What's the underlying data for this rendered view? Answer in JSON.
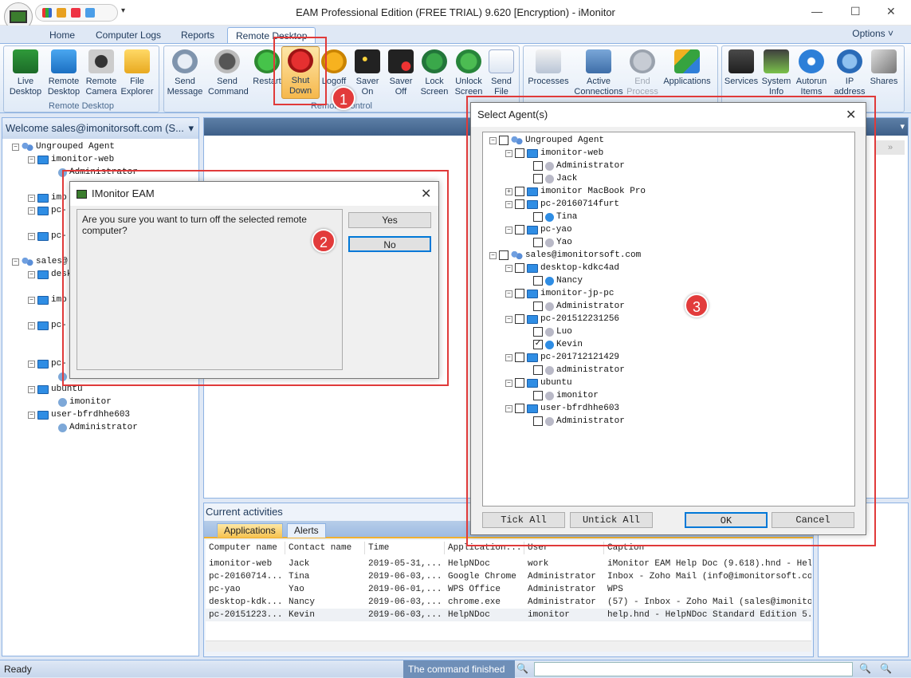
{
  "window": {
    "title": "EAM Professional Edition (FREE TRIAL) 9.620 [Encryption) - iMonitor",
    "minimize": "—",
    "maximize": "☐",
    "close": "✕"
  },
  "tabs": [
    "Home",
    "Computer Logs",
    "Reports",
    "Remote Desktop"
  ],
  "options": "Options ˅",
  "ribbon": {
    "group_remote_desktop": "Remote Desktop",
    "group_remote_control": "Remote Control",
    "live_desktop": "Live\nDesktop",
    "remote_desktop": "Remote\nDesktop",
    "remote_camera": "Remote\nCamera",
    "file_explorer": "File\nExplorer",
    "send_message": "Send\nMessage",
    "send_command": "Send\nCommand",
    "restart": "Restart",
    "shut_down": "Shut\nDown",
    "logoff": "Logoff",
    "saver_on": "Saver\nOn",
    "saver_off": "Saver\nOff",
    "lock_screen": "Lock\nScreen",
    "unlock_screen": "Unlock\nScreen",
    "send_file": "Send\nFile",
    "processes": "Processes",
    "active_connections": "Active\nConnections",
    "end_process": "End\nProcess",
    "applications": "Applications",
    "services": "Services",
    "system_info": "System\nInfo",
    "autorun_items": "Autorun\nItems",
    "ip_address": "IP\naddress",
    "shares": "Shares"
  },
  "left": {
    "welcome": "Welcome sales@imonitorsoft.com (S...",
    "tree": [
      {
        "label": "Ungrouped Agent"
      },
      {
        "label": "imonitor-web"
      },
      {
        "label": "Administrator"
      },
      {
        "label": "imo"
      },
      {
        "label": "pc-"
      },
      {
        "label": "pc-"
      },
      {
        "label": "sales@"
      },
      {
        "label": "desk"
      },
      {
        "label": "imo"
      },
      {
        "label": "pc-"
      },
      {
        "label": "pc-"
      },
      {
        "label": "administrator"
      },
      {
        "label": "ubuntu"
      },
      {
        "label": "imonitor"
      },
      {
        "label": "user-bfrdhhe603"
      },
      {
        "label": "Administrator"
      }
    ]
  },
  "activities": {
    "title": "Current activities",
    "tab_apps": "Applications",
    "tab_alerts": "Alerts",
    "columns": [
      "Computer name",
      "Contact name",
      "Time",
      "Application...",
      "User",
      "Caption"
    ],
    "rows": [
      [
        "imonitor-web",
        "Jack",
        "2019-05-31,...",
        "HelpNDoc",
        "work",
        "iMonitor EAM Help Doc (9.618).hnd - HelpND"
      ],
      [
        "pc-20160714...",
        "Tina",
        "2019-06-03,...",
        "Google Chrome",
        "Administrator",
        "Inbox - Zoho Mail (info@imonitorsoft.com)"
      ],
      [
        "pc-yao",
        "Yao",
        "2019-06-01,...",
        "WPS Office",
        "Administrator",
        "WPS"
      ],
      [
        "desktop-kdk...",
        "Nancy",
        "2019-06-03,...",
        "chrome.exe",
        "Administrator",
        "(57) - Inbox - Zoho Mail (sales@imonitorso"
      ],
      [
        "pc-20151223...",
        "Kevin",
        "2019-06-03,...",
        "HelpNDoc",
        "imonitor",
        "help.hnd - HelpNDoc Standard Edition 5.4.2"
      ]
    ]
  },
  "status": {
    "ready": "Ready",
    "command": "The command finished"
  },
  "confirm": {
    "title": "IMonitor EAM",
    "message": "Are you sure you want to turn off the selected remote computer?",
    "yes": "Yes",
    "no": "No"
  },
  "select": {
    "title": "Select Agent(s)",
    "tick_all": "Tick All",
    "untick_all": "Untick All",
    "ok": "OK",
    "cancel": "Cancel",
    "tree": [
      {
        "label": "Ungrouped Agent",
        "checked": false
      },
      {
        "label": "imonitor-web",
        "checked": false
      },
      {
        "label": "Administrator",
        "checked": false
      },
      {
        "label": "Jack",
        "checked": false
      },
      {
        "label": "imonitor MacBook Pro",
        "checked": false
      },
      {
        "label": "pc-20160714furt",
        "checked": false
      },
      {
        "label": "Tina",
        "checked": false
      },
      {
        "label": "pc-yao",
        "checked": false
      },
      {
        "label": "Yao",
        "checked": false
      },
      {
        "label": "sales@imonitorsoft.com",
        "checked": false
      },
      {
        "label": "desktop-kdkc4ad",
        "checked": false
      },
      {
        "label": "Nancy",
        "checked": false
      },
      {
        "label": "imonitor-jp-pc",
        "checked": false
      },
      {
        "label": "Administrator",
        "checked": false
      },
      {
        "label": "pc-201512231256",
        "checked": false
      },
      {
        "label": "Luo",
        "checked": false
      },
      {
        "label": "Kevin",
        "checked": true
      },
      {
        "label": "pc-201712121429",
        "checked": false
      },
      {
        "label": "administrator",
        "checked": false
      },
      {
        "label": "ubuntu",
        "checked": false
      },
      {
        "label": "imonitor",
        "checked": false
      },
      {
        "label": "user-bfrdhhe603",
        "checked": false
      },
      {
        "label": "Administrator",
        "checked": false
      }
    ]
  },
  "badges": [
    "1",
    "2",
    "3"
  ]
}
